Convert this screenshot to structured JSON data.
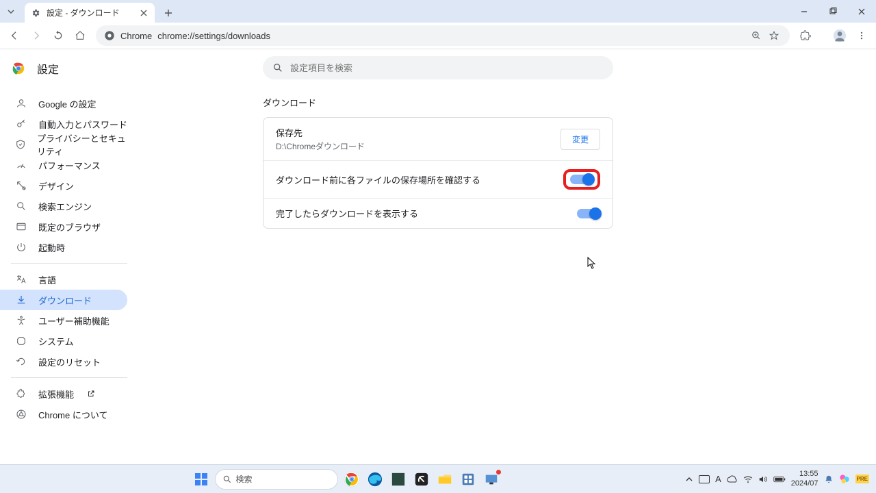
{
  "tab": {
    "title": "設定 - ダウンロード"
  },
  "omnibox": {
    "prefix": "Chrome",
    "url": "chrome://settings/downloads"
  },
  "settings_title": "設定",
  "search_placeholder": "設定項目を検索",
  "sidebar": {
    "items": [
      {
        "label": "Google の設定"
      },
      {
        "label": "自動入力とパスワード"
      },
      {
        "label": "プライバシーとセキュリティ"
      },
      {
        "label": "パフォーマンス"
      },
      {
        "label": "デザイン"
      },
      {
        "label": "検索エンジン"
      },
      {
        "label": "既定のブラウザ"
      },
      {
        "label": "起動時"
      }
    ],
    "items2": [
      {
        "label": "言語"
      },
      {
        "label": "ダウンロード"
      },
      {
        "label": "ユーザー補助機能"
      },
      {
        "label": "システム"
      },
      {
        "label": "設定のリセット"
      }
    ],
    "items3": [
      {
        "label": "拡張機能"
      },
      {
        "label": "Chrome について"
      }
    ]
  },
  "section_title": "ダウンロード",
  "rows": {
    "location_label": "保存先",
    "location_value": "D:\\Chromeダウンロード",
    "change_btn": "変更",
    "ask_label": "ダウンロード前に各ファイルの保存場所を確認する",
    "show_label": "完了したらダウンロードを表示する"
  },
  "taskbar": {
    "search": "検索",
    "time": "13:55",
    "date": "2024/07"
  }
}
